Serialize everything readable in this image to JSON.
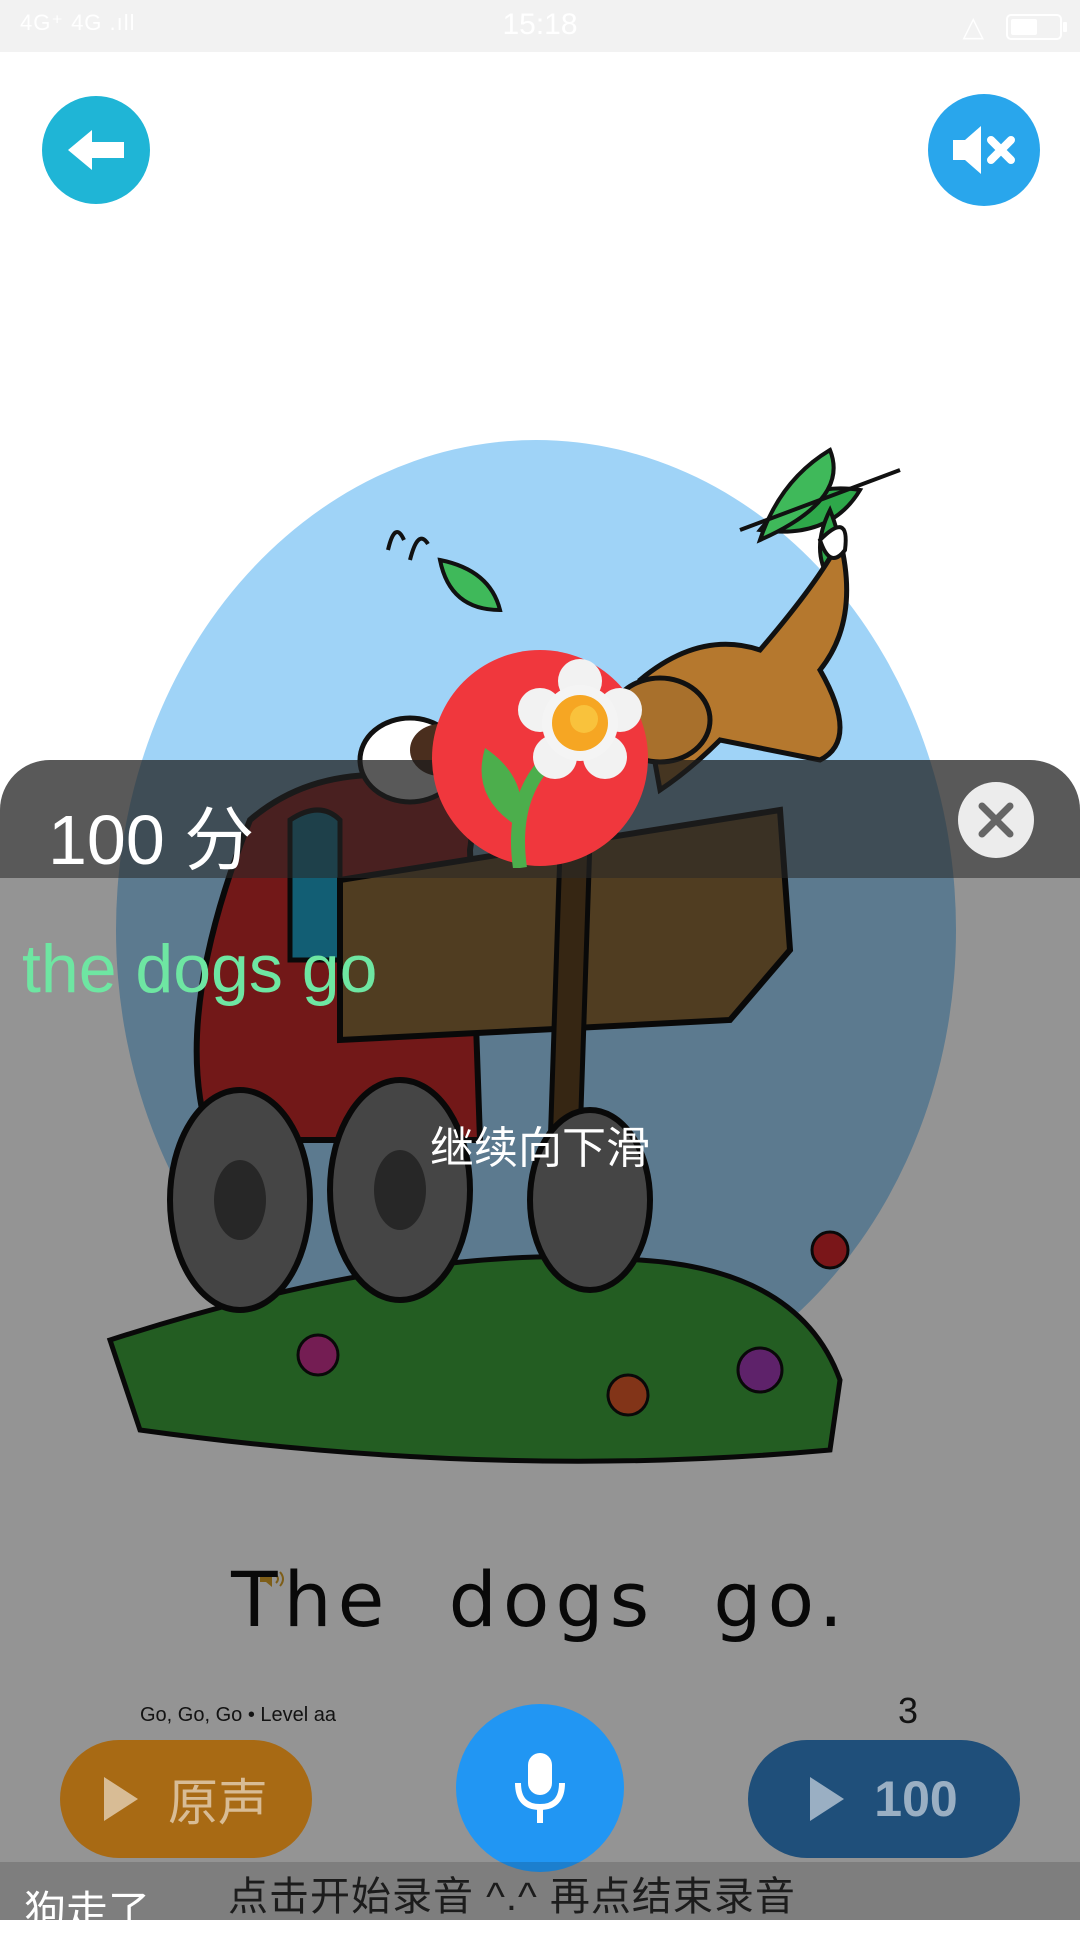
{
  "status_bar": {
    "signal": "4G⁺ 4G .ıll",
    "time": "15:18"
  },
  "header": {
    "back_icon": "arrow-left-icon",
    "mute_icon": "speaker-mute-icon"
  },
  "book": {
    "sentence": "The dogs go.",
    "caption": "Go, Go, Go • Level aa",
    "page_number": "3"
  },
  "result": {
    "score": "100 分",
    "recognized_text": "the dogs go",
    "hint": "继续向下滑"
  },
  "controls": {
    "original_label": "原声",
    "playback_label": "100",
    "record_icon": "microphone-icon"
  },
  "footer": {
    "translation": "狗走了",
    "record_hint": "点击开始录音 ^.^ 再点结束录音"
  },
  "colors": {
    "back_button": "#1fb5d6",
    "mute_button": "#29a6ec",
    "record_button": "#2196f3",
    "recognized_text": "#6ee6a2",
    "badge": "#f0373d"
  }
}
